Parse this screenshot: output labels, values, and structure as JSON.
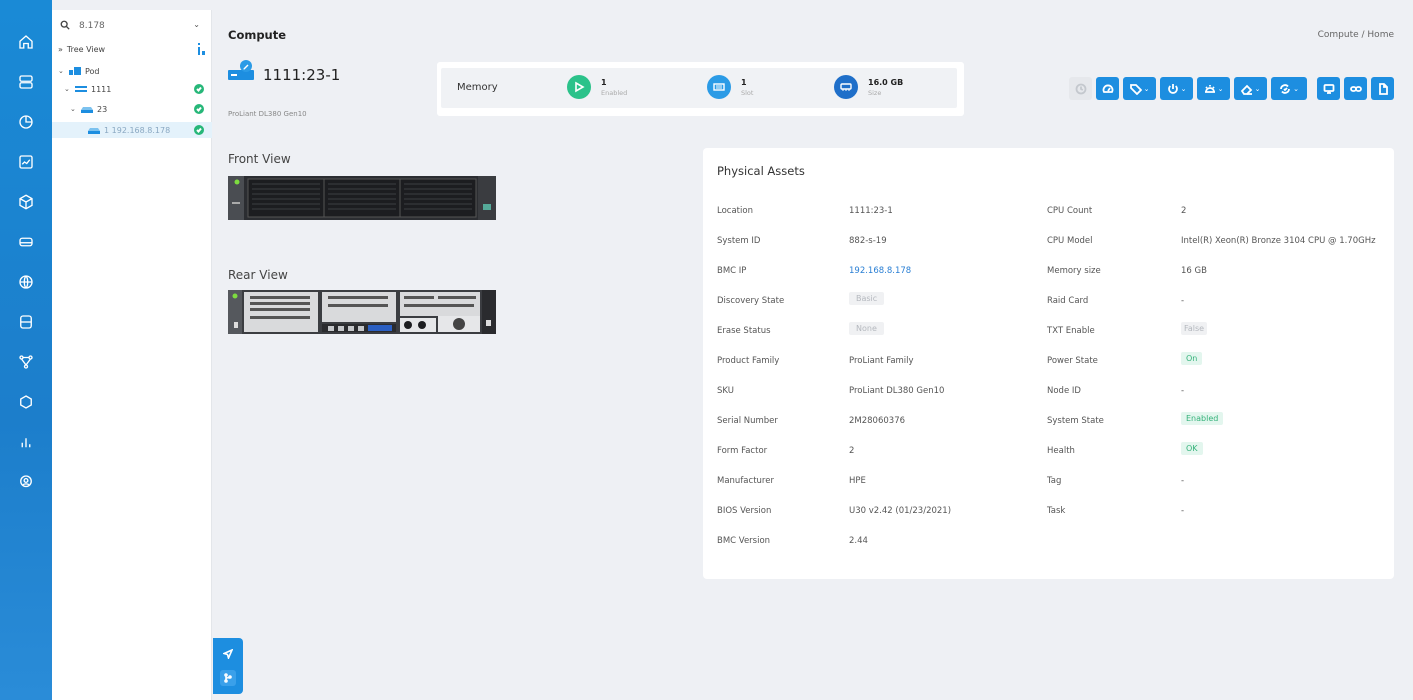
{
  "tree": {
    "search_value": "8.178",
    "tree_view_label": "Tree View",
    "nodes": [
      {
        "label": "Pod"
      },
      {
        "label": "1111"
      },
      {
        "label": "23"
      },
      {
        "label": "1 192.168.8.178"
      }
    ]
  },
  "header": {
    "title": "Compute",
    "breadcrumb": "Compute / Home"
  },
  "host": {
    "name": "1111:23-1",
    "model": "ProLiant DL380 Gen10"
  },
  "memory": {
    "label": "Memory",
    "stats": [
      {
        "value": "1",
        "label": "Enabled",
        "color": "#2bc28a"
      },
      {
        "value": "1",
        "label": "Slot",
        "color": "#2b9be6"
      },
      {
        "value": "16.0 GB",
        "label": "Size",
        "color": "#1f6fc9"
      }
    ]
  },
  "views": {
    "front_label": "Front View",
    "rear_label": "Rear View"
  },
  "physical_assets": {
    "title": "Physical Assets",
    "left": [
      {
        "key": "Location",
        "value": "1111:23-1"
      },
      {
        "key": "System ID",
        "value": "882-s-19"
      },
      {
        "key": "BMC IP",
        "value": "192.168.8.178"
      },
      {
        "key": "Discovery State",
        "value": "Basic"
      },
      {
        "key": "Erase Status",
        "value": "None"
      },
      {
        "key": "Product Family",
        "value": "ProLiant Family"
      },
      {
        "key": "SKU",
        "value": "ProLiant DL380 Gen10"
      },
      {
        "key": "Serial Number",
        "value": "2M28060376"
      },
      {
        "key": "Form Factor",
        "value": "2"
      },
      {
        "key": "Manufacturer",
        "value": "HPE"
      },
      {
        "key": "BIOS Version",
        "value": "U30 v2.42 (01/23/2021)"
      },
      {
        "key": "BMC Version",
        "value": "2.44"
      }
    ],
    "right": [
      {
        "key": "CPU Count",
        "value": "2"
      },
      {
        "key": "CPU Model",
        "value": "Intel(R) Xeon(R) Bronze 3104 CPU @ 1.70GHz"
      },
      {
        "key": "Memory size",
        "value": "16 GB"
      },
      {
        "key": "Raid Card",
        "value": "-"
      },
      {
        "key": "TXT Enable",
        "value": "False"
      },
      {
        "key": "Power State",
        "value": "On"
      },
      {
        "key": "Node ID",
        "value": "-"
      },
      {
        "key": "System State",
        "value": "Enabled"
      },
      {
        "key": "Health",
        "value": "OK"
      },
      {
        "key": "Tag",
        "value": "-"
      },
      {
        "key": "Task",
        "value": "-"
      }
    ]
  },
  "colors": {
    "accent": "#1d8ee0",
    "success": "#27b779"
  }
}
